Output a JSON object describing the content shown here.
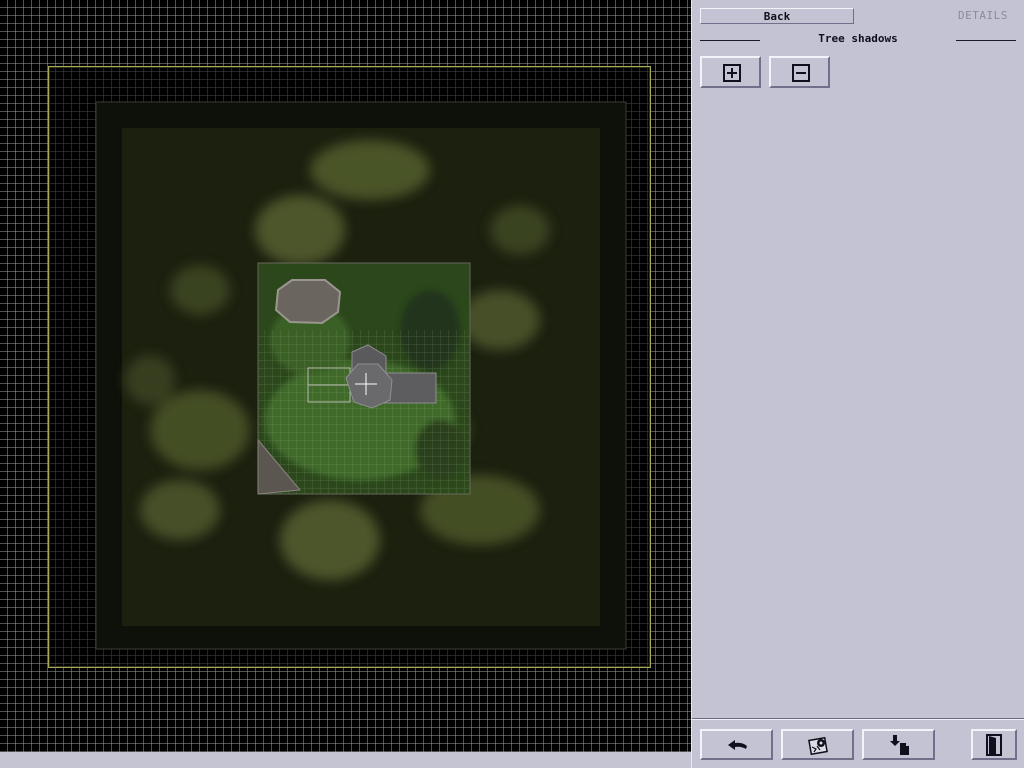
{
  "window": {
    "title": ""
  },
  "map": {
    "colors": {
      "frame": "#a9a95a",
      "grid": "#969696",
      "terrain": "#3f4a22"
    }
  },
  "panel": {
    "back_label": "Back",
    "details_label": "DETAILS",
    "section_title": "Tree shadows",
    "buttons": {
      "zoom_in_icon": "plus-box-icon",
      "zoom_out_icon": "minus-box-icon"
    },
    "toolbar": [
      {
        "icon": "undo-arrow-icon"
      },
      {
        "icon": "map-settings-icon"
      },
      {
        "icon": "import-icon"
      },
      {
        "icon": "exit-door-icon"
      }
    ],
    "colors": {
      "panel_bg": "#c3c3d3",
      "text": "#10101c",
      "muted": "#8b8b9f"
    }
  }
}
